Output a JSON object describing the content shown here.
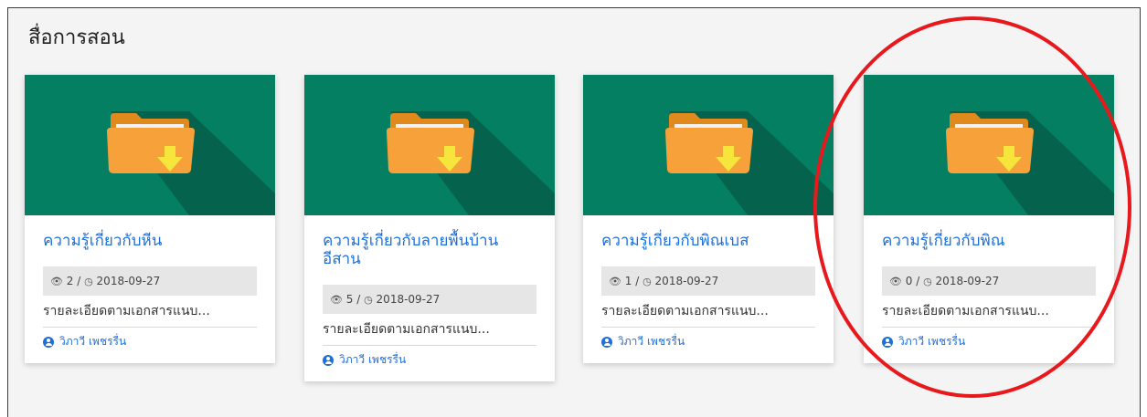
{
  "section": {
    "title": "สื่อการสอน"
  },
  "cards": [
    {
      "title": "ความรู้เกี่ยวกับหีน",
      "views": "2",
      "date": "2018-09-27",
      "description": "รายละเอียดตามเอกสารแนบ...",
      "author": "วิภาวี เพชรรื่น"
    },
    {
      "title": "ความรู้เกี่ยวกับลายพื้นบ้าน อีสาน",
      "views": "5",
      "date": "2018-09-27",
      "description": "รายละเอียดตามเอกสารแนบ...",
      "author": "วิภาวี เพชรรื่น"
    },
    {
      "title": "ความรู้เกี่ยวกับพิณเบส",
      "views": "1",
      "date": "2018-09-27",
      "description": "รายละเอียดตามเอกสารแนบ...",
      "author": "วิภาวี เพชรรื่น"
    },
    {
      "title": "ความรู้เกี่ยวกับพิณ",
      "views": "0",
      "date": "2018-09-27",
      "description": "รายละเอียดตามเอกสารแนบ...",
      "author": "วิภาวี เพชรรื่น"
    }
  ],
  "icons": {
    "thumbnail": "folder-download-icon",
    "views": "eye-icon",
    "date": "clock-icon",
    "author": "user-circle-icon"
  },
  "colors": {
    "thumbnail_bg": "#047f62",
    "link": "#1e6fd9",
    "highlight": "#e8191d"
  }
}
